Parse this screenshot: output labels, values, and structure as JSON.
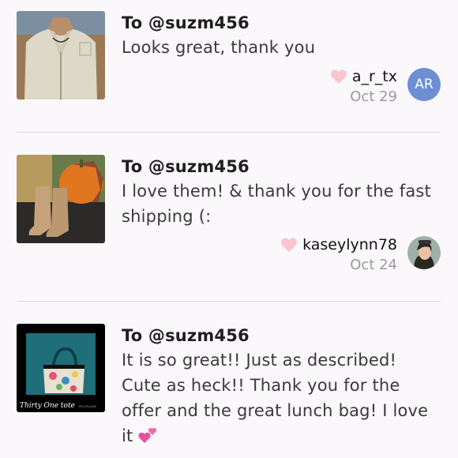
{
  "reviews": [
    {
      "to": "To @suzm456",
      "message": "Looks great, thank you",
      "username": "a_r_tx",
      "date": "Oct 29",
      "avatar_initials": "AR",
      "avatar_color": "#6c8fd4"
    },
    {
      "to": "To @suzm456",
      "message_line1": "I love them! & thank you for the fast",
      "message_line2": "shipping (:",
      "username": "kaseylynn78",
      "date": "Oct 24"
    },
    {
      "to": "To @suzm456",
      "message_line1": "It is so great!! Just as described!",
      "message_line2": "Cute as heck!! Thank you for the",
      "message_line3": "offer and the great lunch bag! I love",
      "message_line4": "it",
      "emoji": "two-hearts-icon",
      "thumb_caption": "Thirty One tote",
      "thumb_watermark": "PICCOLLAGE"
    }
  ],
  "colors": {
    "background": "#fbf8fb",
    "heart": "#f7c6cf",
    "divider": "#d8d8d8",
    "date": "#9a9a9a"
  }
}
